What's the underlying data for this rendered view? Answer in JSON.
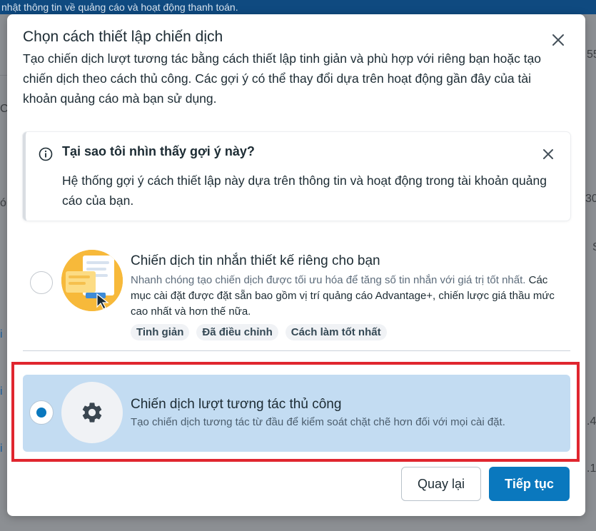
{
  "background": {
    "banner_text": "nhật thông tin về quảng cáo và hoạt động thanh toán.",
    "fragments": [
      "55",
      "C",
      "ó",
      "30",
      "S",
      "i",
      "i",
      ".4",
      "i",
      ".1"
    ]
  },
  "modal": {
    "title": "Chọn cách thiết lập chiến dịch",
    "description": "Tạo chiến dịch lượt tương tác bằng cách thiết lập tinh giản và phù hợp với riêng bạn hoặc tạo chiến dịch theo cách thủ công. Các gợi ý có thể thay đổi dựa trên hoạt động gần đây của tài khoản quảng cáo mà bạn sử dụng.",
    "close_icon": "close-icon"
  },
  "info": {
    "title": "Tại sao tôi nhìn thấy gợi ý này?",
    "body": "Hệ thống gợi ý cách thiết lập này dựa trên thông tin và hoạt động trong tài khoản quảng cáo của bạn.",
    "icon": "info-icon"
  },
  "options": [
    {
      "title": "Chiến dịch tin nhắn thiết kế riêng cho bạn",
      "desc_muted": "Nhanh chóng tạo chiến dịch được tối ưu hóa để tăng số tin nhắn với giá trị tốt nhất.",
      "desc": "Các mục cài đặt được đặt sẵn bao gồm vị trí quảng cáo Advantage+, chiến lược giá thầu mức cao nhất và hơn thế nữa.",
      "tags": [
        "Tinh giản",
        "Đã điều chỉnh",
        "Cách làm tốt nhất"
      ],
      "selected": false
    },
    {
      "title": "Chiến dịch lượt tương tác thủ công",
      "desc": "Tạo chiến dịch tương tác từ đầu để kiểm soát chặt chẽ hơn đối với mọi cài đặt.",
      "icon": "gear-icon",
      "selected": true
    }
  ],
  "footer": {
    "back_label": "Quay lại",
    "next_label": "Tiếp tục"
  },
  "colors": {
    "primary": "#0a78be",
    "selected_bg": "#c3dcf2",
    "highlight_border": "#e0262f"
  }
}
